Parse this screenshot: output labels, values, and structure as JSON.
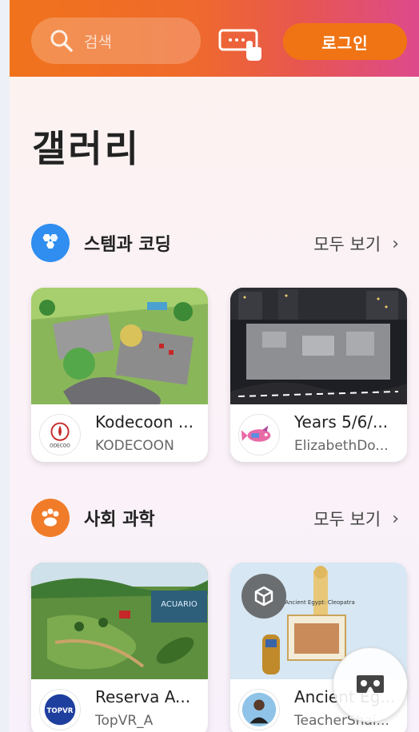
{
  "header": {
    "search_placeholder": "검색",
    "login_label": "로그인"
  },
  "page_title": "갤러리",
  "sections": [
    {
      "label": "스템과 코딩",
      "see_all": "모두 보기",
      "cards": [
        {
          "title": "Kodecoon ...",
          "author": "KODECOON",
          "avatar_text": "ODECOO"
        },
        {
          "title": "Years 5/6/...",
          "author": "ElizabethDo..."
        }
      ]
    },
    {
      "label": "사회 과학",
      "see_all": "모두 보기",
      "cards": [
        {
          "title": "Reserva A...",
          "author": "TopVR_A",
          "avatar_text": "TOPVR",
          "thumb_text": "ACUARIO"
        },
        {
          "title": "Ancient Eg...",
          "author": "TeacherShai...",
          "thumb_text": "Ancient Egypt: Cleopatra"
        }
      ]
    }
  ],
  "colors": {
    "accent_orange": "#f07413",
    "stem_icon": "#2f8ef0",
    "social_icon": "#f07c2a"
  }
}
